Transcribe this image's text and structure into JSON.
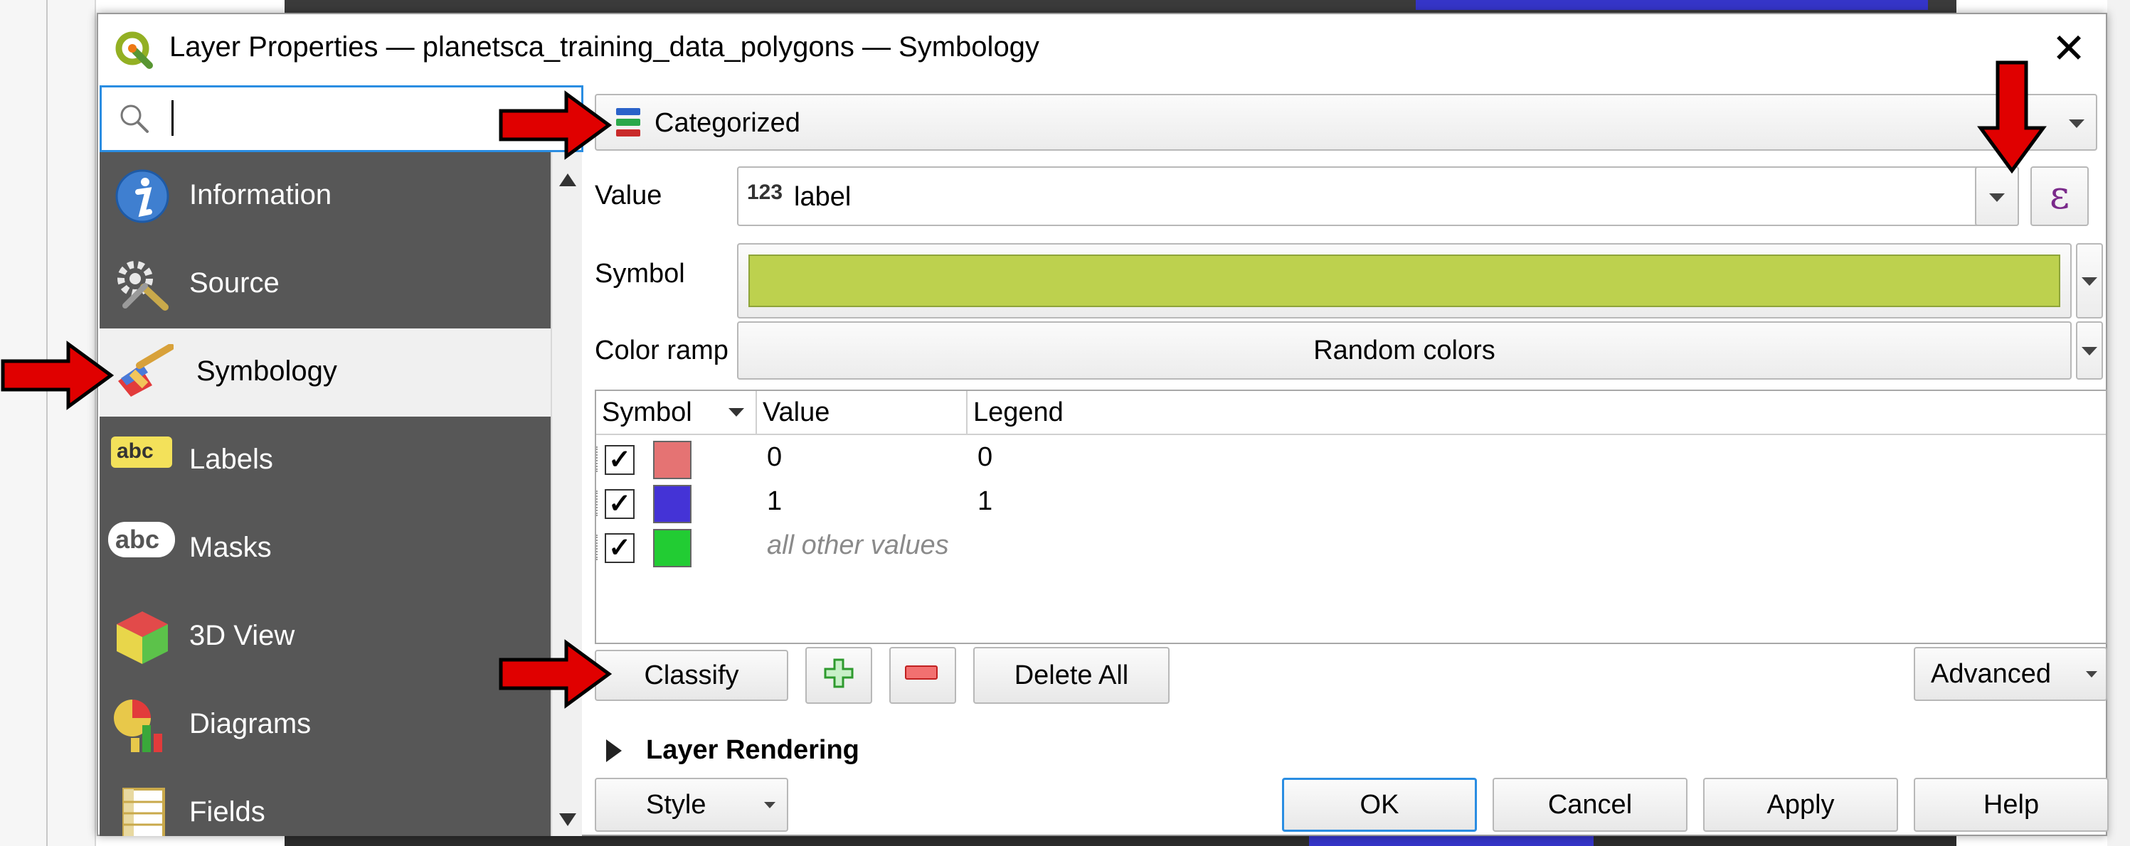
{
  "dialog": {
    "title": "Layer Properties — planetsca_training_data_polygons — Symbology",
    "close_glyph": "✕"
  },
  "search": {
    "placeholder": "",
    "value": ""
  },
  "sidebar": {
    "items": [
      {
        "label": "Information",
        "icon": "information-icon"
      },
      {
        "label": "Source",
        "icon": "source-icon"
      },
      {
        "label": "Symbology",
        "icon": "symbology-icon",
        "selected": true
      },
      {
        "label": "Labels",
        "icon": "labels-icon"
      },
      {
        "label": "Masks",
        "icon": "masks-icon"
      },
      {
        "label": "3D View",
        "icon": "3d-view-icon"
      },
      {
        "label": "Diagrams",
        "icon": "diagrams-icon"
      },
      {
        "label": "Fields",
        "icon": "fields-icon"
      }
    ],
    "abc_text": "abc"
  },
  "renderer": {
    "selected": "Categorized"
  },
  "value_row": {
    "label": "Value",
    "type_badge": "123",
    "field": "label",
    "expression_glyph": "ε"
  },
  "symbol_row": {
    "label": "Symbol",
    "color": "#bdd14e"
  },
  "color_ramp": {
    "label": "Color ramp",
    "value": "Random colors"
  },
  "table": {
    "headers": [
      "Symbol",
      "Value",
      "Legend"
    ],
    "rows": [
      {
        "checked": true,
        "check_glyph": "✓",
        "color": "#e57373",
        "value": "0",
        "legend": "0"
      },
      {
        "checked": true,
        "check_glyph": "✓",
        "color": "#4433d6",
        "value": "1",
        "legend": "1"
      },
      {
        "checked": true,
        "check_glyph": "✓",
        "color": "#22cc33",
        "value": "all other values",
        "legend": ""
      }
    ]
  },
  "buttons": {
    "classify": "Classify",
    "delete_all": "Delete All",
    "advanced": "Advanced",
    "style": "Style",
    "ok": "OK",
    "cancel": "Cancel",
    "apply": "Apply",
    "help": "Help"
  },
  "layer_rendering": {
    "label": "Layer Rendering"
  },
  "annotations": {
    "arrow_color": "#e00000"
  }
}
